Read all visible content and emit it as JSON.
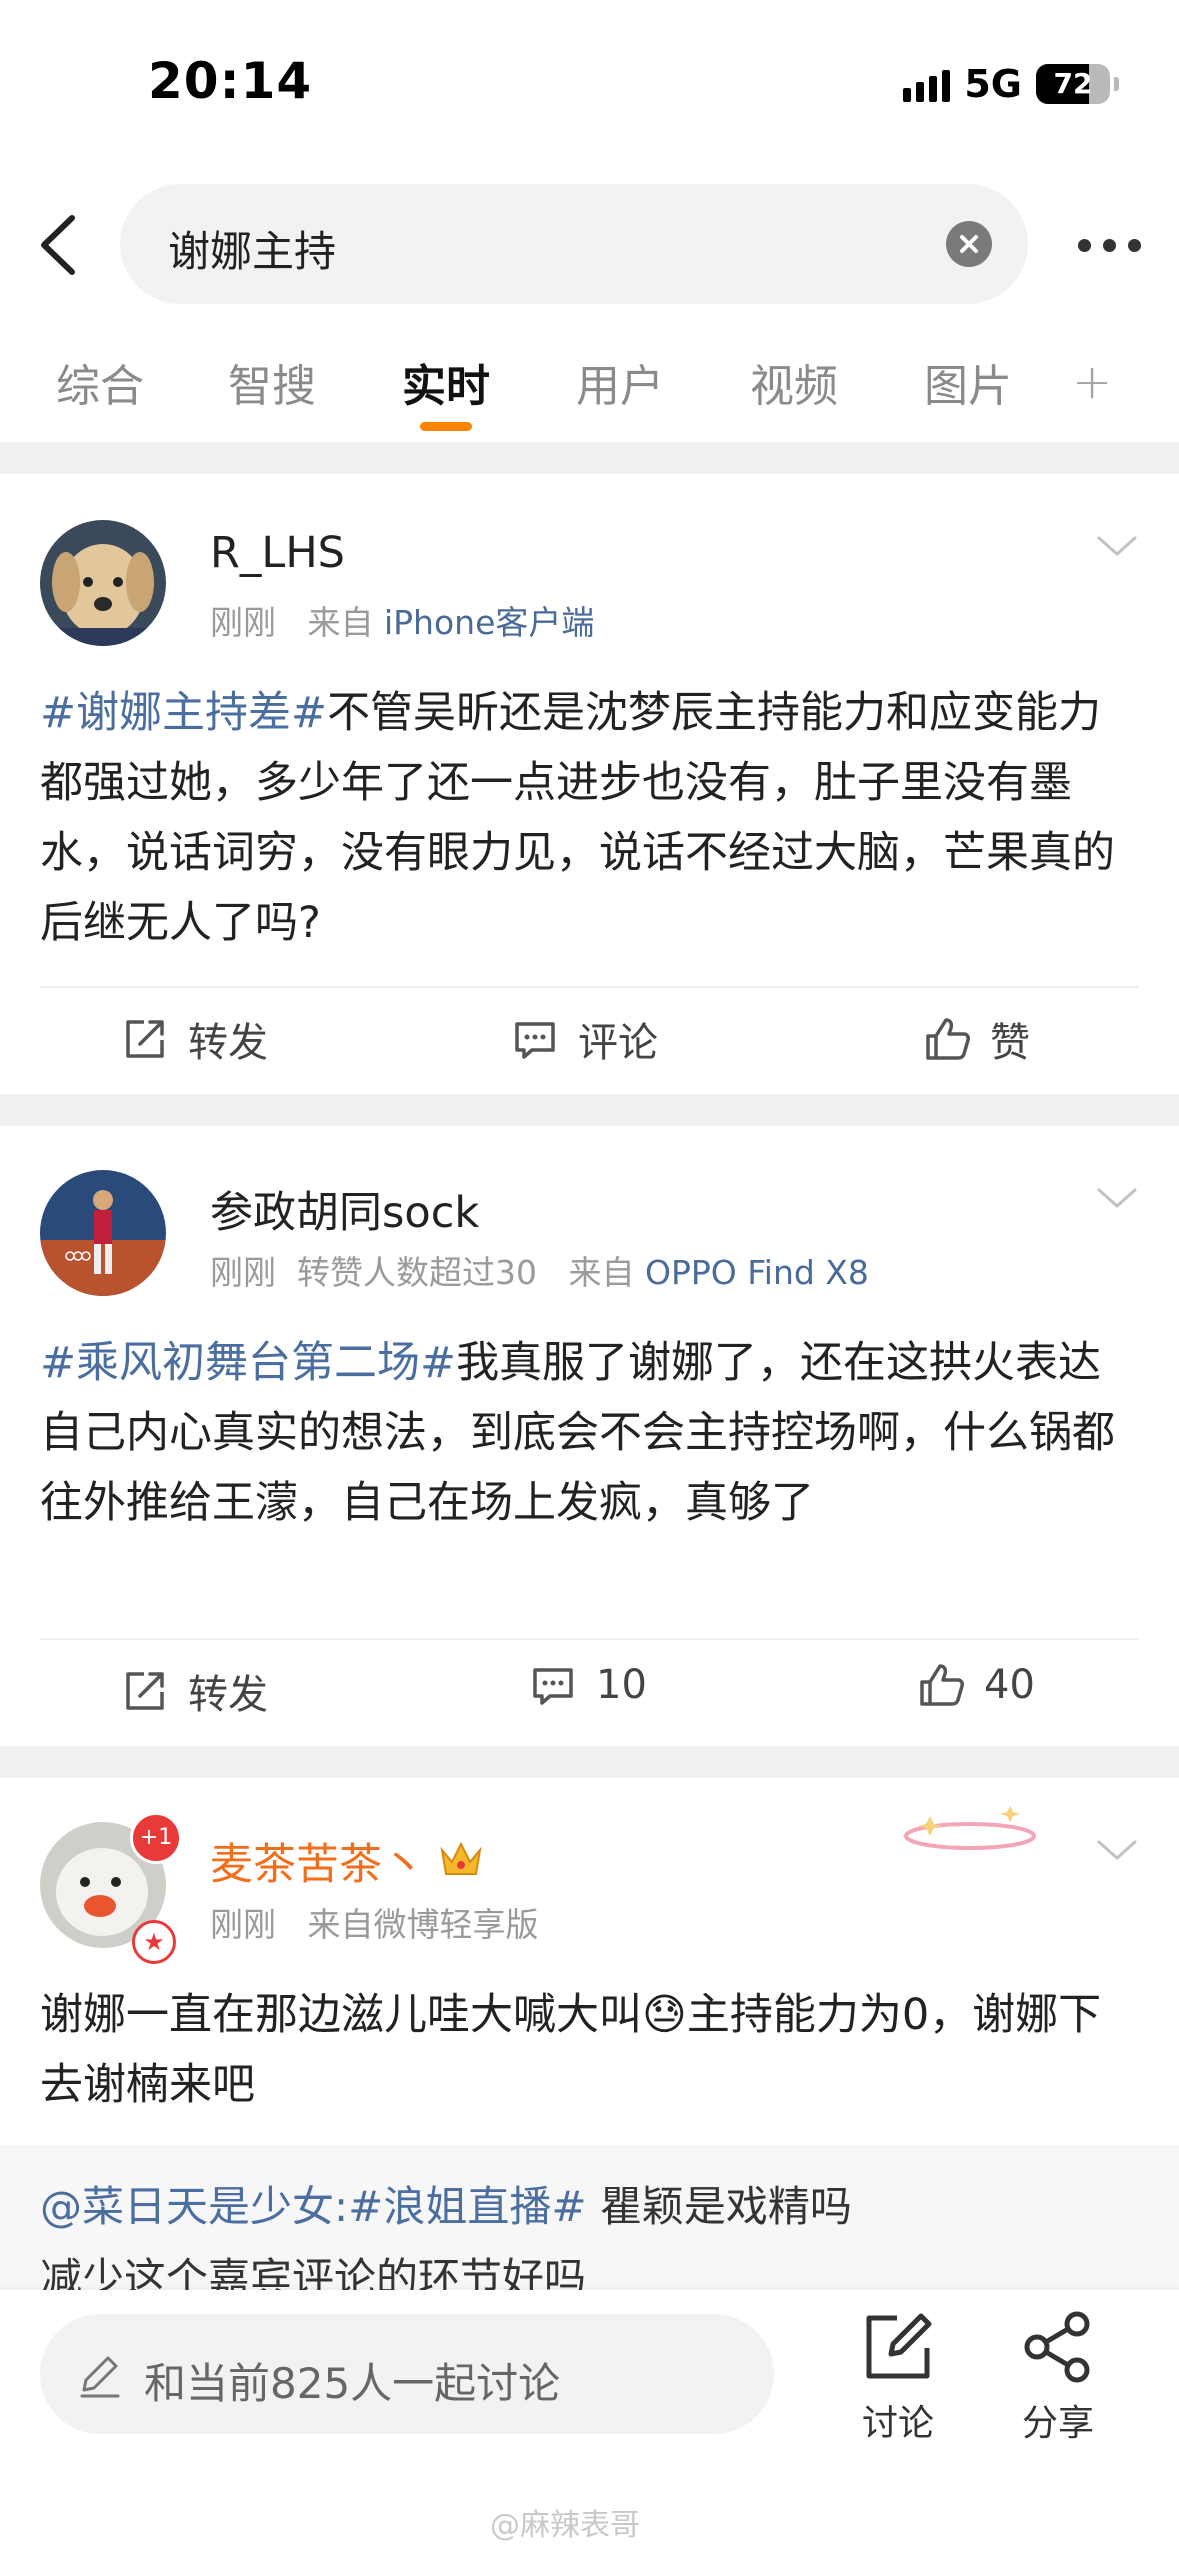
{
  "status_bar": {
    "time": "20:14",
    "network": "5G",
    "battery": "72"
  },
  "search": {
    "query": "谢娜主持"
  },
  "tabs": [
    {
      "label": "综合",
      "active": false
    },
    {
      "label": "智搜",
      "active": false
    },
    {
      "label": "实时",
      "active": true
    },
    {
      "label": "用户",
      "active": false
    },
    {
      "label": "视频",
      "active": false
    },
    {
      "label": "图片",
      "active": false
    }
  ],
  "tab_plus": "+",
  "posts": [
    {
      "user": "R_LHS",
      "time": "刚刚",
      "from_prefix": "来自",
      "source": "iPhone客户端",
      "hashtag": "#谢娜主持差#",
      "text": "不管吴昕还是沈梦辰主持能力和应变能力都强过她，多少年了还一点进步也没有，肚子里没有墨水，说话词穷，没有眼力见，说话不经过大脑，芒果真的后继无人了吗?",
      "actions": {
        "repost": "转发",
        "comment": "评论",
        "like": "赞"
      }
    },
    {
      "user": "参政胡同sock",
      "time": "刚刚",
      "extra": "转赞人数超过30",
      "from_prefix": "来自",
      "source": "OPPO Find X8",
      "hashtag": "#乘风初舞台第二场#",
      "text": "我真服了谢娜了，还在这拱火表达自己内心真实的想法，到底会不会主持控场啊，什么锅都往外推给王濛，自己在场上发疯，真够了",
      "actions": {
        "repost": "转发",
        "comment": "10",
        "like": "40"
      }
    },
    {
      "user": "麦茶苦茶丶",
      "badge": "+1",
      "time": "刚刚",
      "from_prefix": "来自",
      "source": "微博轻享版",
      "text_before": "谢娜一直在那边滋儿哇大喊大叫",
      "emoji": "😓",
      "text_after": "主持能力为0，谢娜下去谢楠来吧"
    }
  ],
  "quote": {
    "mention": "@菜日天是少女:",
    "hashtag": "#浪姐直播#",
    "line1_rest": " 瞿颖是戏精吗",
    "line2": "减少这个嘉宾评论的环节好吗"
  },
  "bottom_bar": {
    "comment_placeholder": "和当前825人一起讨论",
    "discuss_label": "讨论",
    "share_label": "分享"
  },
  "watermark": "@麻辣表哥",
  "colors": {
    "accent": "#ff8200",
    "link": "#4b6ea0",
    "vip_name": "#f26e1b"
  }
}
